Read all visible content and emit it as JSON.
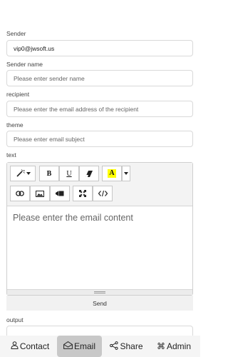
{
  "form": {
    "sender": {
      "label": "Sender",
      "value": "vip0@jwsoft.us"
    },
    "sender_name": {
      "label": "Sender name",
      "placeholder": "Please enter sender name"
    },
    "recipient": {
      "label": "recipient",
      "placeholder": "Please enter the email address of the recipient"
    },
    "theme": {
      "label": "theme",
      "placeholder": "Please enter email subject"
    },
    "text": {
      "label": "text",
      "placeholder": "Please enter the email content"
    },
    "send_label": "Send",
    "output": {
      "label": "output"
    }
  },
  "toolbar": {
    "bold": "B",
    "underline": "U",
    "font_color": "A",
    "icons": [
      "magic-wand-icon",
      "chevron-down-icon",
      "bold-icon",
      "underline-icon",
      "eraser-icon",
      "font-color-icon",
      "link-icon",
      "picture-icon",
      "video-icon",
      "fullscreen-icon",
      "code-view-icon"
    ],
    "highlight_color": "#ffff00"
  },
  "nav": {
    "items": [
      {
        "label": "Contact",
        "icon": "person-icon"
      },
      {
        "label": "Email",
        "icon": "envelope-icon",
        "active": true
      },
      {
        "label": "Share",
        "icon": "share-icon"
      },
      {
        "label": "Admin",
        "icon": "command-icon"
      }
    ]
  }
}
